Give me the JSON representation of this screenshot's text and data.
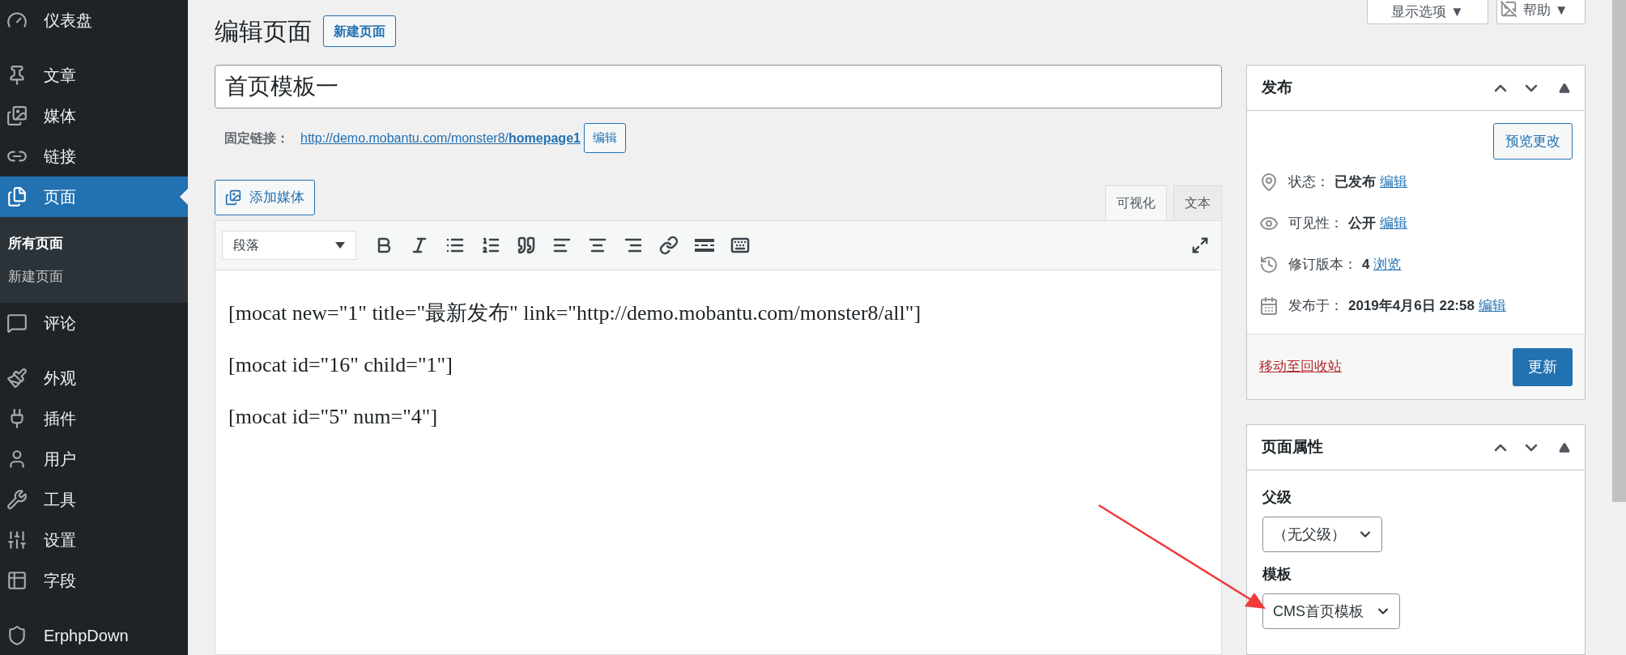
{
  "sidebar": {
    "items": [
      {
        "label": "仪表盘",
        "selected": false
      },
      {
        "label": "文章",
        "selected": false
      },
      {
        "label": "媒体",
        "selected": false
      },
      {
        "label": "链接",
        "selected": false
      },
      {
        "label": "页面",
        "selected": true,
        "children": [
          {
            "label": "所有页面",
            "selected": true
          },
          {
            "label": "新建页面",
            "selected": false
          }
        ]
      },
      {
        "label": "评论",
        "selected": false
      },
      {
        "label": "外观",
        "selected": false
      },
      {
        "label": "插件",
        "selected": false
      },
      {
        "label": "用户",
        "selected": false
      },
      {
        "label": "工具",
        "selected": false
      },
      {
        "label": "设置",
        "selected": false
      },
      {
        "label": "字段",
        "selected": false
      },
      {
        "label": "ErphpDown",
        "selected": false
      }
    ]
  },
  "screen_tabs": [
    "显示选项 ▼",
    "帮助 ▼"
  ],
  "heading": {
    "title": "编辑页面",
    "action": "新建页面"
  },
  "post_title": "首页模板一",
  "permalink": {
    "label": "固定链接：",
    "url": "http://demo.mobantu.com/monster8/**homepage1**",
    "button": "编辑"
  },
  "add_media": "添加媒体",
  "editor_tabs": [
    {
      "label": "可视化",
      "selected": true
    },
    {
      "label": "文本",
      "selected": false
    }
  ],
  "format_select": "段落",
  "content": [
    "[mocat new=\"1\" title=\"最新发布\" link=\"http://demo.mobantu.com/monster8/all\"]",
    "[mocat id=\"16\" child=\"1\"]",
    "[mocat id=\"5\" num=\"4\"]"
  ],
  "publish_box": {
    "title": "发布",
    "preview": "预览更改",
    "rows": [
      {
        "label": "状态：",
        "value": "已发布",
        "link": "编辑"
      },
      {
        "label": "可见性：",
        "value": "公开",
        "link": "编辑"
      },
      {
        "label": "修订版本：",
        "value": "4",
        "link": "浏览"
      },
      {
        "label": "发布于：",
        "value": "2019年4月6日 22:58",
        "link": "编辑"
      }
    ],
    "trash": "移动至回收站",
    "update": "更新"
  },
  "attributes_box": {
    "title": "页面属性",
    "fields": [
      {
        "label": "父级",
        "value": "（无父级）"
      },
      {
        "label": "模板",
        "value": "CMS首页模板"
      }
    ]
  }
}
